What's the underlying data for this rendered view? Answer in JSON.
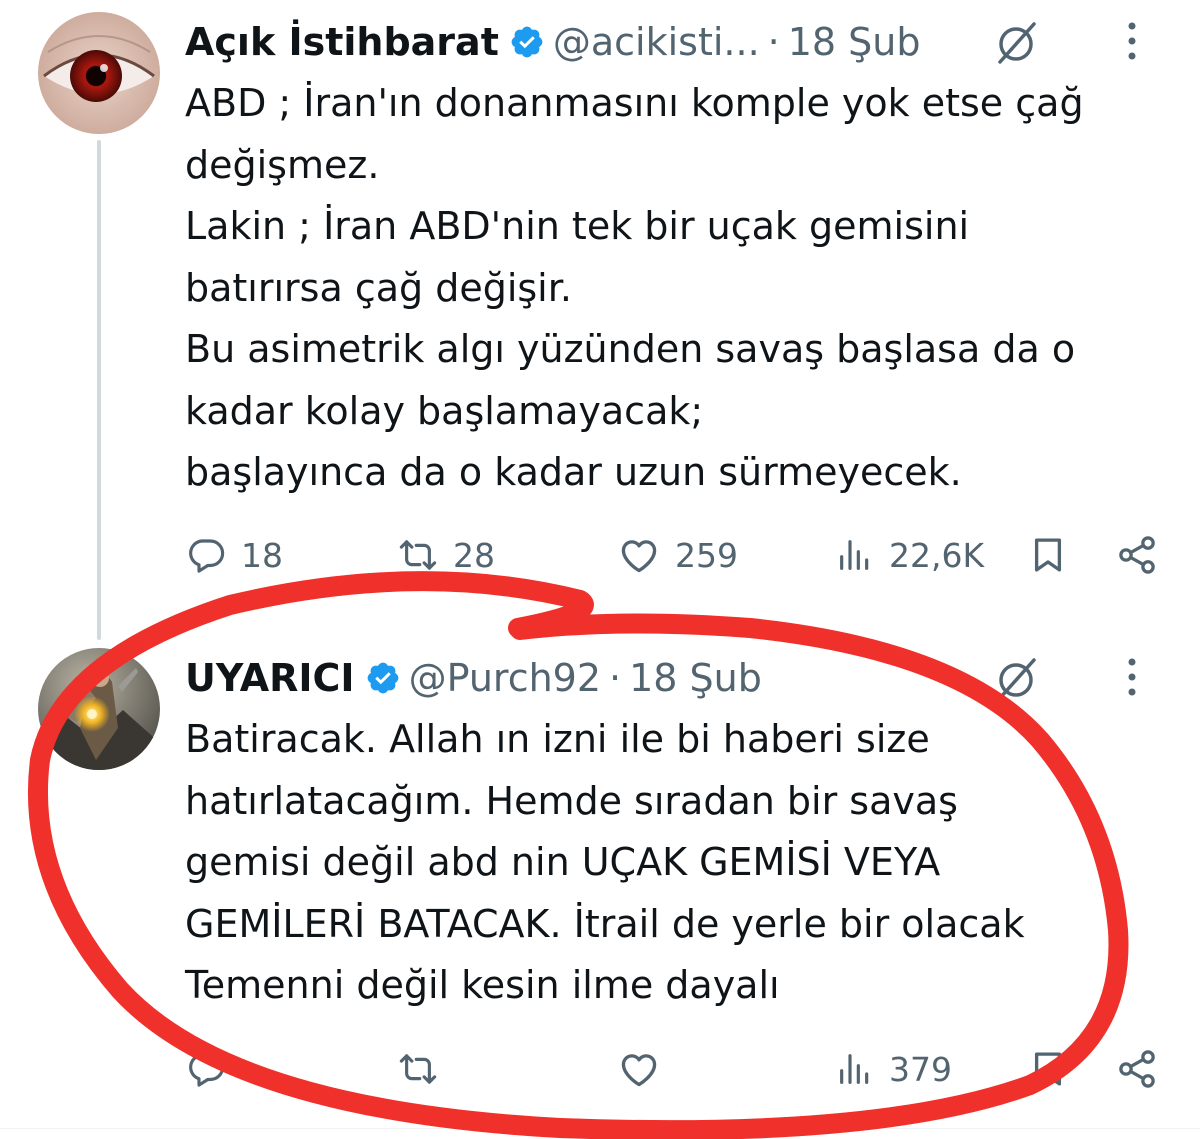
{
  "tweets": [
    {
      "display_name": "Açık İstihbarat",
      "handle": "@acikisti...",
      "separator": "·",
      "date": "18 Şub",
      "lines": [
        "ABD ; İran'ın donanmasını komple yok etse çağ",
        "değişmez.",
        "Lakin ; İran ABD'nin tek bir uçak gemisini",
        "batırırsa çağ değişir.",
        "Bu asimetrik algı yüzünden savaş başlasa da o",
        "kadar kolay başlamayacak;",
        "başlayınca da o kadar uzun sürmeyecek."
      ],
      "replies": "18",
      "reposts": "28",
      "likes": "259",
      "views": "22,6K"
    },
    {
      "display_name": "UYARICI",
      "handle": "@Purch92",
      "separator": "·",
      "date": "18 Şub",
      "lines": [
        "Batiracak. Allah ın izni ile bi haberi size",
        "hatırlatacağım. Hemde sıradan bir savaş",
        "gemisi değil abd nin UÇAK GEMİSİ VEYA",
        "GEMİLERİ BATACAK. İtrail de yerle bir olacak",
        "Temenni değil kesin ilme dayalı"
      ],
      "views": "379"
    }
  ],
  "colors": {
    "verified": "#1d9bf0",
    "text": "#0f1419",
    "secondary": "#536471",
    "annotation_circle": "#f0302a",
    "thread_line": "#cfd9de"
  },
  "icons": [
    "verified-badge-icon",
    "grok-icon",
    "more-icon",
    "reply-icon",
    "repost-icon",
    "like-icon",
    "views-icon",
    "bookmark-icon",
    "share-icon"
  ]
}
